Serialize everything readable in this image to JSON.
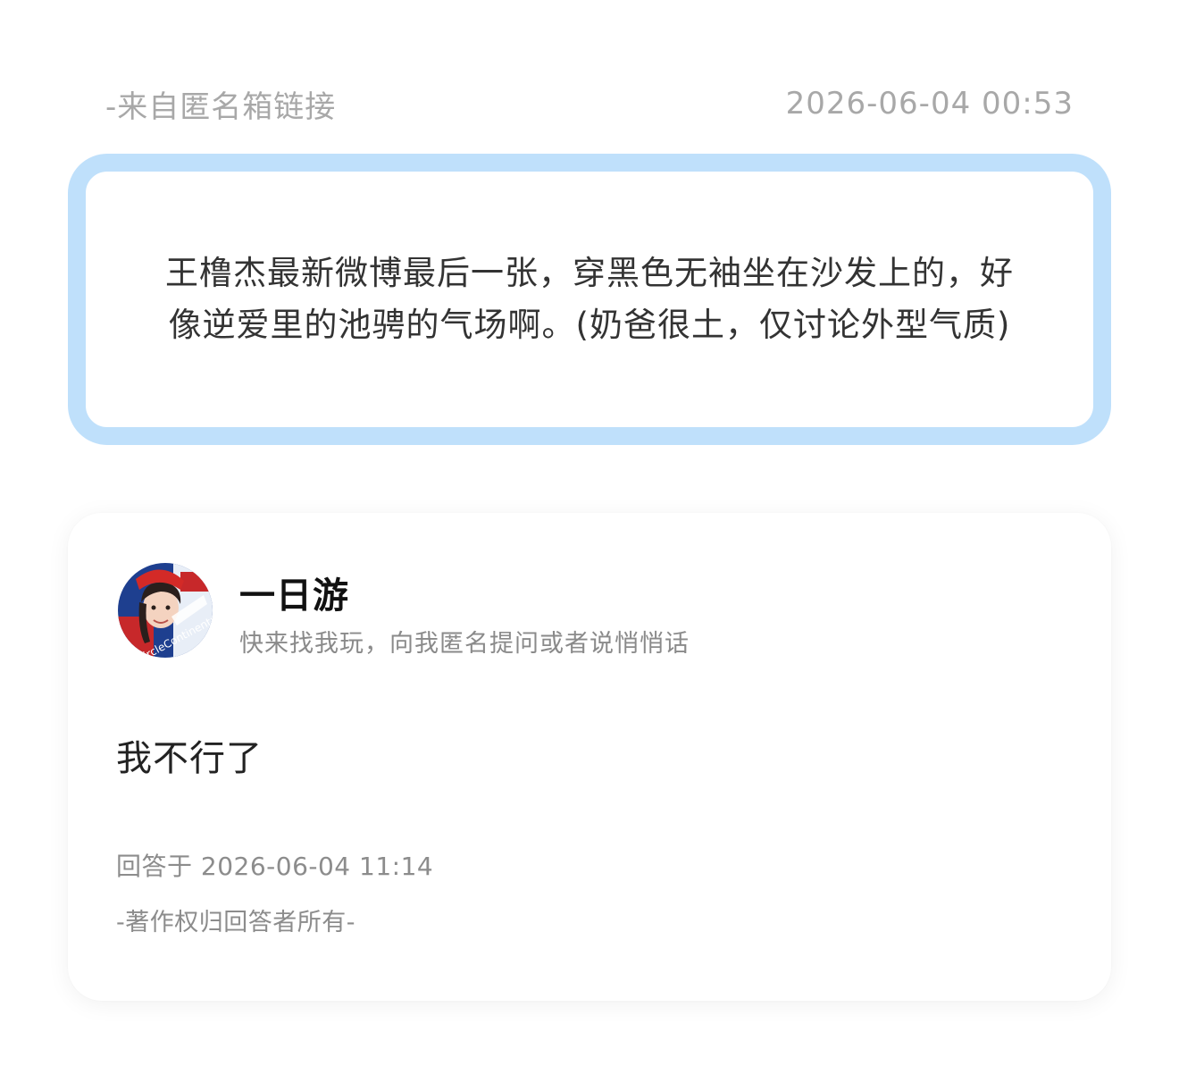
{
  "header": {
    "source": "-来自匿名箱链接",
    "timestamp": "2026-06-04 00:53"
  },
  "question": {
    "text": "王橹杰最新微博最后一张，穿黑色无袖坐在沙发上的，好像逆爱里的池骋的气场啊。(奶爸很土，仅讨论外型气质)"
  },
  "answer": {
    "user": {
      "name": "一日游",
      "bio": "快来找我玩，向我匿名提问或者说悄悄话",
      "avatar_icon": "user-avatar-icon"
    },
    "text": "我不行了",
    "answered_at": "回答于 2026-06-04 11:14",
    "copyright": "-著作权归回答者所有-"
  },
  "colors": {
    "question_border": "#bfe0fb",
    "meta_text": "#a8a8a8",
    "secondary_text": "#8c8c8c"
  }
}
